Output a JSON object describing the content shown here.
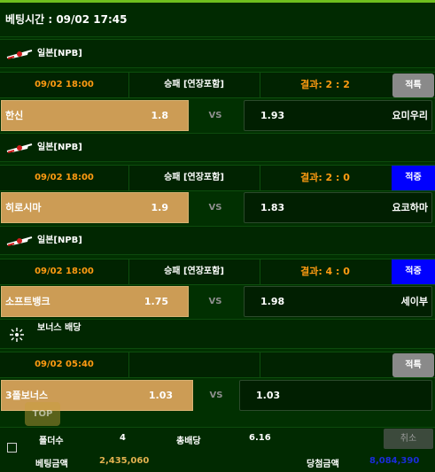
{
  "header": {
    "bet_time": "베팅시간 : 09/02 17:45"
  },
  "leagues": [
    {
      "league_name": "일본[NPB]",
      "time": "09/02 18:00",
      "market": "승패 [연장포함]",
      "result": "결과: 2 : 2",
      "status": "적특",
      "home_team": "한신",
      "home_odd": "1.8",
      "vs": "VS",
      "away_odd": "1.93",
      "away_team": "요미우리"
    },
    {
      "league_name": "일본[NPB]",
      "time": "09/02 18:00",
      "market": "승패 [연장포함]",
      "result": "결과: 2 : 0",
      "status": "적중",
      "home_team": "히로시마",
      "home_odd": "1.9",
      "vs": "VS",
      "away_odd": "1.83",
      "away_team": "요코하마"
    },
    {
      "league_name": "일본[NPB]",
      "time": "09/02 18:00",
      "market": "승패 [연장포함]",
      "result": "결과: 4 : 0",
      "status": "적중",
      "home_team": "소프트뱅크",
      "home_odd": "1.75",
      "vs": "VS",
      "away_odd": "1.98",
      "away_team": "세이부"
    },
    {
      "league_name": "보너스 배당",
      "time": "09/02 05:40",
      "market": "",
      "result": "",
      "status": "적특",
      "home_team": "3폴보너스",
      "home_odd": "1.03",
      "vs": "VS",
      "away_odd": "1.03",
      "away_team": ""
    }
  ],
  "footer": {
    "fold_label": "폴더수",
    "fold_value": "4",
    "total_odds_label": "총배당",
    "total_odds_value": "6.16",
    "cancel_label": "취소",
    "bet_amount_label": "베팅금액",
    "bet_amount_value": "2,435,060",
    "win_amount_label": "당첨금액",
    "win_amount_value": "8,084,390",
    "top_label": "TOP"
  },
  "colors": {
    "accent_orange": "#ff9b12",
    "home_gold": "#cc9c55",
    "win_blue": "#0000ff",
    "void_grey": "#8a8a8a",
    "amount_gold": "#e1b14f",
    "win_amount_blue": "#1a2cd9"
  },
  "icons": {
    "league_icon": "japan-flag-icon",
    "bonus_icon": "sparkle-icon"
  }
}
